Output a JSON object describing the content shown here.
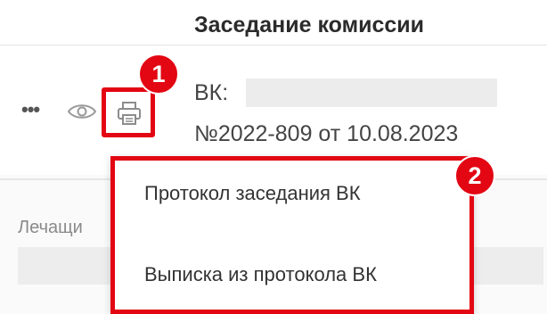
{
  "header": {
    "title": "Заседание комиссии"
  },
  "record": {
    "vk_label": "ВК:",
    "number": "№2022-809 от 10.08.2023"
  },
  "annotations": {
    "badge_1": "1",
    "badge_2": "2",
    "highlight_color": "#e30613"
  },
  "actions": {
    "more": "more-icon",
    "view": "eye-icon",
    "print": "print-icon"
  },
  "menu": {
    "items": [
      {
        "label": "Протокол заседания ВК"
      },
      {
        "label": "Выписка из протокола ВК"
      }
    ]
  },
  "background": {
    "field_label": "Лечащи"
  }
}
